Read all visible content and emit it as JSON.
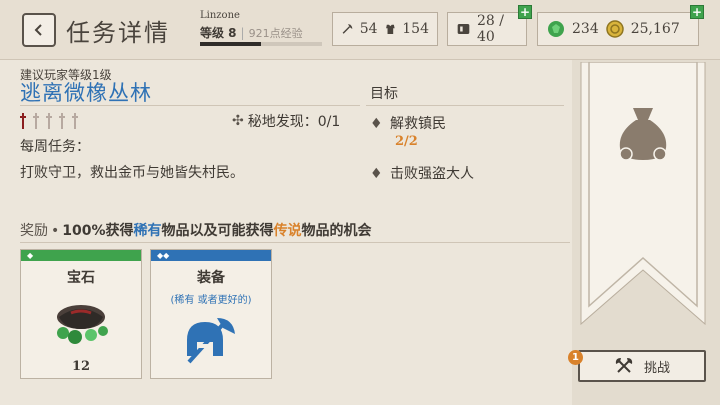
{
  "header": {
    "title": "任务详情",
    "player_name": "Linzone",
    "level": "等级 8",
    "xp": "921点经验",
    "xp_progress": 0.5
  },
  "resources": {
    "attack": "54",
    "defense": "154",
    "slots": "28 / 40",
    "gems": "234",
    "gold": "25,167"
  },
  "quest": {
    "recommend": "建议玩家等级1级",
    "title": "逃离微橡丛林",
    "difficulty_filled": 1,
    "difficulty_total": 5,
    "secret": "秘地发现：0/1",
    "weekly": "每周任务：",
    "description": "打败守卫，救出金币与她皆失村民。"
  },
  "objectives": {
    "header": "目标",
    "items": [
      {
        "label": "解救镇民",
        "progress": "2/2"
      },
      {
        "label": "击败强盗大人",
        "progress": ""
      }
    ]
  },
  "rewards": {
    "prefix": "奖励",
    "bullet": "•",
    "text_a": "100%获得",
    "rare": "稀有",
    "text_b": "物品以及可能获得",
    "legendary": "传说",
    "text_c": "物品的机会",
    "cards": [
      {
        "title": "宝石",
        "subtitle": "",
        "count": "12",
        "band_color": "#3fa34d",
        "marks": "◆"
      },
      {
        "title": "装备",
        "subtitle": "(稀有 或者更好的)",
        "count": "",
        "band_color": "#2f72b5",
        "marks": "◆◆"
      }
    ]
  },
  "actions": {
    "challenge_label": "挑战",
    "challenge_badge": "1"
  },
  "colors": {
    "rare": "#2f72b5",
    "legendary": "#d9822b",
    "difficulty": "#8b1e1e"
  }
}
